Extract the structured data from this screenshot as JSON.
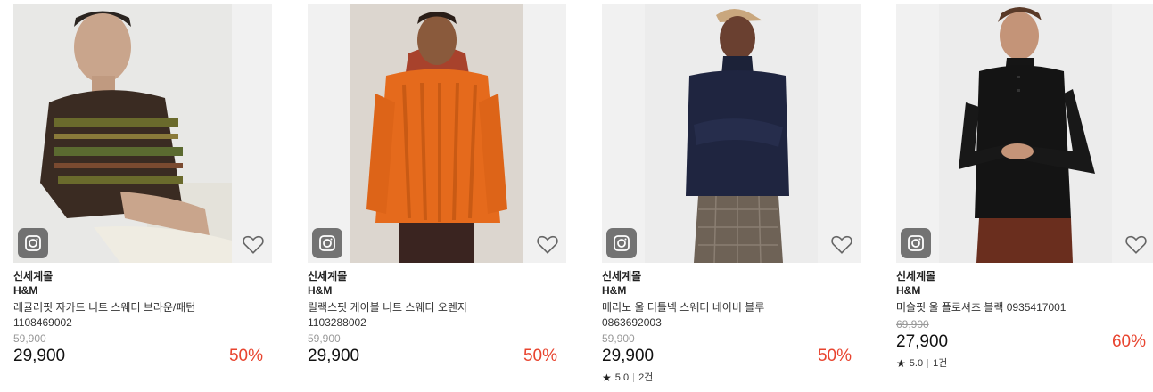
{
  "products": [
    {
      "mall": "신세계몰",
      "brand": "H&M",
      "name": "레귤러핏 자카드 니트 스웨터 브라운/패턴",
      "code": "1108469002",
      "original_price": "59,900",
      "price": "29,900",
      "discount": "50%",
      "rating": "",
      "review_count": ""
    },
    {
      "mall": "신세계몰",
      "brand": "H&M",
      "name": "릴랙스핏 케이블 니트 스웨터 오렌지",
      "code": "1103288002",
      "original_price": "59,900",
      "price": "29,900",
      "discount": "50%",
      "rating": "",
      "review_count": ""
    },
    {
      "mall": "신세계몰",
      "brand": "H&M",
      "name": "메리노 울 터틀넥 스웨터 네이비 블루",
      "code": "0863692003",
      "original_price": "59,900",
      "price": "29,900",
      "discount": "50%",
      "rating": "5.0",
      "review_count": "2건"
    },
    {
      "mall": "신세계몰",
      "brand": "H&M",
      "name": "머슬핏 울 폴로셔츠 블랙 0935417001",
      "code": "",
      "original_price": "69,900",
      "price": "27,900",
      "discount": "60%",
      "rating": "5.0",
      "review_count": "1건"
    }
  ],
  "icons": {
    "camera": "camera-icon",
    "wishlist": "heart-outline-icon",
    "rating": "star-icon"
  },
  "colors": {
    "discount": "#e8442f",
    "strikethrough": "#999999",
    "thumb_bg": "#f1f1f1"
  }
}
